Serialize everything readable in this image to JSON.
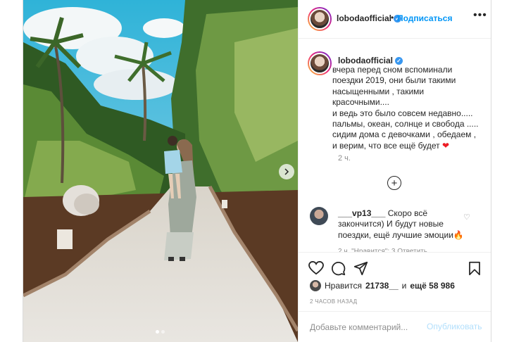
{
  "post": {
    "username": "lobodaofficial",
    "verified_icon": "verified-badge-icon",
    "follow_label": "Подписаться",
    "more_label": "•••",
    "caption_lines": [
      "вчера перед сном вспоминали",
      "поездки 2019, они были такими",
      "насыщенными , такими",
      "красочными....",
      "и ведь это было совсем недавно.....",
      "пальмы, океан, солнце и свобода .....",
      "сидим дома с девочками , обедаем ,",
      "и верим, что все ещё будет"
    ],
    "caption_emoji": "❤",
    "caption_time": "2 ч.",
    "add_icon": "plus-circle-icon"
  },
  "comment": {
    "username": "___vp13___",
    "text_line1": "Скоро всё",
    "text_line2": "закончится) И будут новые",
    "text_line3": "поездки, ещё лучшие эмоции",
    "emoji": "🔥",
    "meta": "2 ч.   \"Нравится\": 3   Ответить"
  },
  "actions": {
    "like_icon": "heart-icon",
    "comment_icon": "comment-icon",
    "share_icon": "share-icon",
    "save_icon": "bookmark-icon"
  },
  "likes": {
    "prefix": "Нравится",
    "liker": "21738__",
    "conj": "и",
    "others": "ещё 58 986"
  },
  "time_ago": "2 ЧАСОВ НАЗАД",
  "add_comment": {
    "placeholder": "Добавьте комментарий...",
    "publish_label": "Опубликовать"
  },
  "carousel": {
    "next_icon": "chevron-right-icon",
    "current_index": 1,
    "total": 2
  },
  "colors": {
    "link_blue": "#0095f6",
    "publish_disabled": "#b2dffc",
    "verified_blue": "#3897f0"
  }
}
